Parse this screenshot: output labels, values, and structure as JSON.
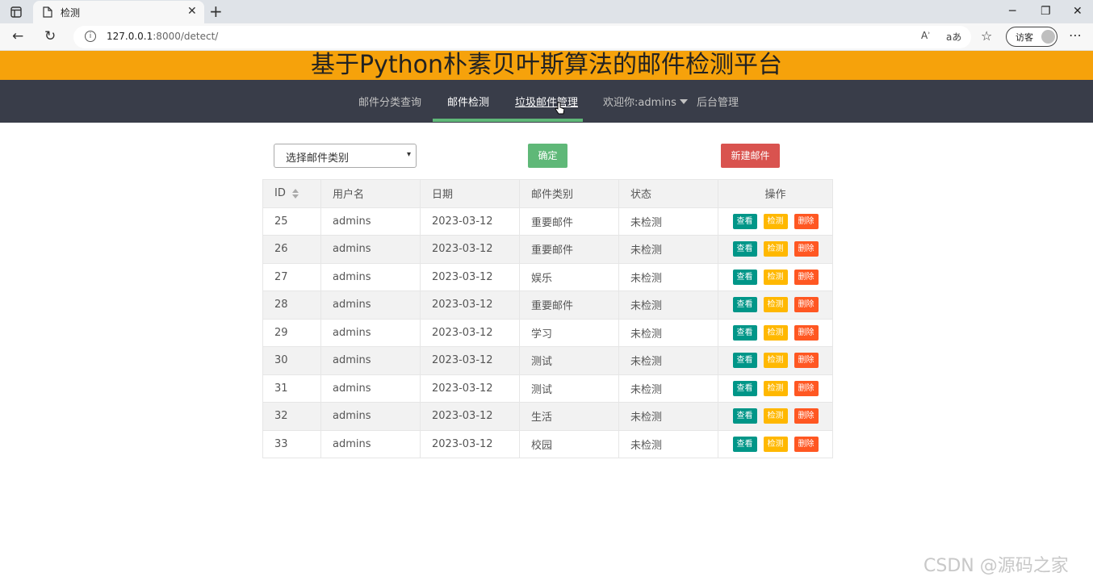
{
  "browser": {
    "tab_title": "检测",
    "url_host": "127.0.0.1",
    "url_rest": ":8000/detect/",
    "profile_label": "访客"
  },
  "page": {
    "banner_title": "基于Python朴素贝叶斯算法的邮件检测平台",
    "nav": {
      "items": [
        {
          "label": "邮件分类查询"
        },
        {
          "label": "邮件检测"
        },
        {
          "label": "垃圾邮件管理"
        },
        {
          "label": "欢迎你:admins"
        },
        {
          "label": "后台管理"
        }
      ]
    },
    "filter": {
      "select_value": "选择邮件类别",
      "confirm_label": "确定",
      "new_label": "新建邮件"
    },
    "table": {
      "headers": [
        "ID",
        "用户名",
        "日期",
        "邮件类别",
        "状态",
        "操作"
      ],
      "rows": [
        {
          "id": "25",
          "user": "admins",
          "date": "2023-03-12",
          "category": "重要邮件",
          "status": "未检测"
        },
        {
          "id": "26",
          "user": "admins",
          "date": "2023-03-12",
          "category": "重要邮件",
          "status": "未检测"
        },
        {
          "id": "27",
          "user": "admins",
          "date": "2023-03-12",
          "category": "娱乐",
          "status": "未检测"
        },
        {
          "id": "28",
          "user": "admins",
          "date": "2023-03-12",
          "category": "重要邮件",
          "status": "未检测"
        },
        {
          "id": "29",
          "user": "admins",
          "date": "2023-03-12",
          "category": "学习",
          "status": "未检测"
        },
        {
          "id": "30",
          "user": "admins",
          "date": "2023-03-12",
          "category": "测试",
          "status": "未检测"
        },
        {
          "id": "31",
          "user": "admins",
          "date": "2023-03-12",
          "category": "测试",
          "status": "未检测"
        },
        {
          "id": "32",
          "user": "admins",
          "date": "2023-03-12",
          "category": "生活",
          "status": "未检测"
        },
        {
          "id": "33",
          "user": "admins",
          "date": "2023-03-12",
          "category": "校园",
          "status": "未检测"
        }
      ],
      "actions": {
        "view": "查看",
        "detect": "检测",
        "delete": "删除"
      }
    }
  },
  "watermark": "CSDN @源码之家",
  "colors": {
    "banner": "#f6a20b",
    "navbar": "#393d49",
    "nav_active_bar": "#5fb878",
    "btn_confirm": "#5fb878",
    "btn_new": "#d9534f",
    "btn_view": "#009688",
    "btn_detect": "#ffb800",
    "btn_delete": "#ff5722"
  }
}
